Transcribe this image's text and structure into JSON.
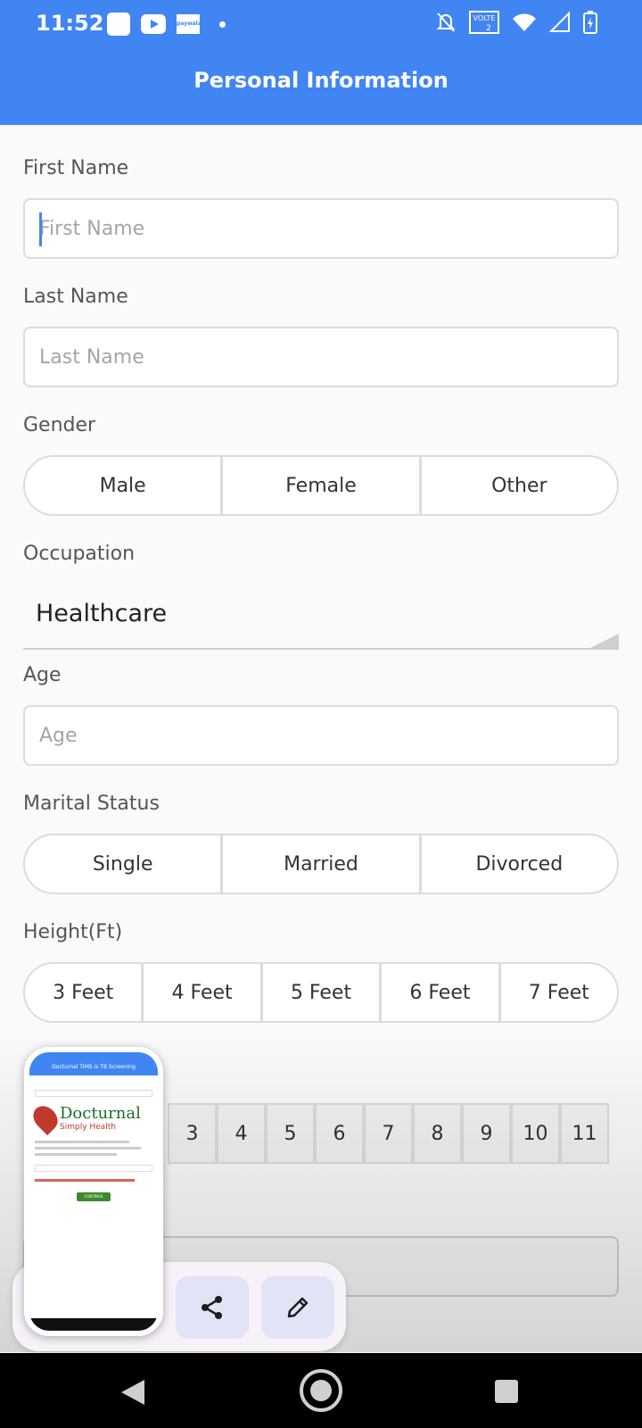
{
  "status_bar": {
    "time": "11:52",
    "brand_icon_text": "paywala",
    "network_label": "VOLTE"
  },
  "header": {
    "title": "Personal Information"
  },
  "form": {
    "first_name": {
      "label": "First Name",
      "placeholder": "First Name"
    },
    "last_name": {
      "label": "Last Name",
      "placeholder": "Last Name"
    },
    "gender": {
      "label": "Gender",
      "options": [
        "Male",
        "Female",
        "Other"
      ]
    },
    "occupation": {
      "label": "Occupation",
      "value": "Healthcare"
    },
    "age": {
      "label": "Age",
      "placeholder": "Age"
    },
    "marital_status": {
      "label": "Marital Status",
      "options": [
        "Single",
        "Married",
        "Divorced"
      ]
    },
    "height_ft": {
      "label": "Height(Ft)",
      "options": [
        "3 Feet",
        "4 Feet",
        "5 Feet",
        "6 Feet",
        "7 Feet"
      ]
    },
    "height_in": {
      "options": [
        "3",
        "4",
        "5",
        "6",
        "7",
        "8",
        "9",
        "10",
        "11"
      ]
    }
  },
  "preview": {
    "header_title": "Docturnal TIMS is TB Screening",
    "brand": "Docturnal",
    "tagline": "Simply Health",
    "button": "CONTINUE"
  },
  "accent_color": "#4185f3"
}
